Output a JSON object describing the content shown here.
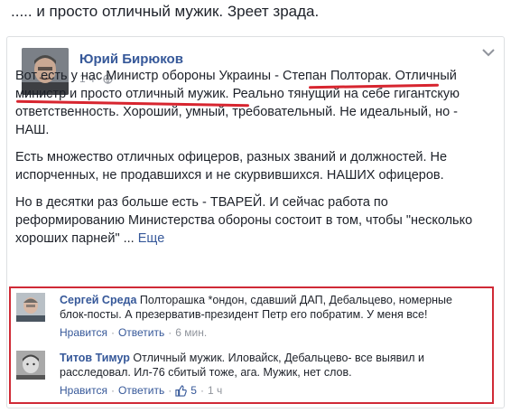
{
  "caption": "..... и просто отличный мужик. Зреет зрада.",
  "post": {
    "author": "Юрий Бирюков",
    "time": "1 ч",
    "paragraphs": {
      "p1_a": "Вот есть у нас Министр обороны Украины - ",
      "p1_b": "Степан Полторак. Отличный министр и просто отличный мужик.",
      "p1_c": " Реально тянущий на себе гигантскую ответственность. Хороший, умный, требовательный. Не идеальный, но - НАШ.",
      "p2": "Есть множество отличных офицеров, разных званий и должностей. Не испорченных, не продавшихся и не скурвившихся. НАШИХ офицеров.",
      "p3": "Но в десятки раз больше есть - ТВАРЕЙ. И сейчас работа по реформированию Министерства обороны состоит в том, чтобы \"несколько хороших парней\" ...",
      "see_more": "Еще"
    },
    "highlight_color": "#d7252f"
  },
  "comments": [
    {
      "name": "Сергей Среда",
      "text": " Полторашка *ондон, сдавший ДАП, Дебальцево, номерные блок-посты. А презерватив-президент Петр его побратим. У меня все!",
      "like": "Нравится",
      "reply": "Ответить",
      "time": "6 мин."
    },
    {
      "name": "Титов Тимур",
      "text": " Отличный мужик. Иловайск, Дебальцево- все выявил и расследовал. Ил-76 сбитый тоже, ага. Мужик, нет слов.",
      "like": "Нравится",
      "reply": "Ответить",
      "likes_count": "5",
      "time": "1 ч"
    }
  ],
  "colors": {
    "link": "#365899",
    "meta": "#90949c",
    "box": "#d02a36"
  }
}
